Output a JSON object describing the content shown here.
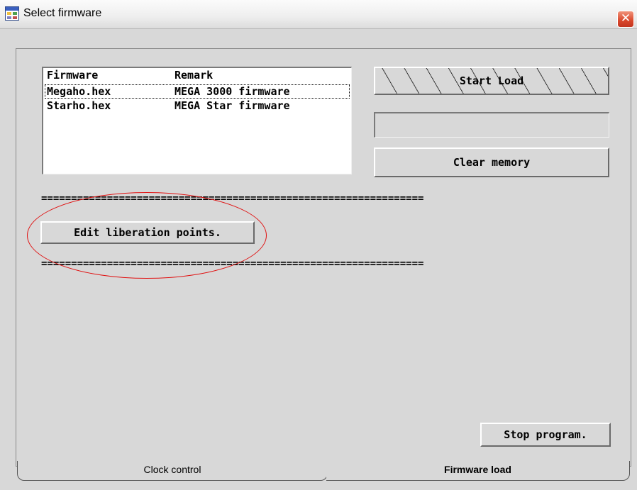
{
  "window": {
    "title": "Select firmware",
    "close_symbol": "✕"
  },
  "firmware_list": {
    "headers": [
      "Firmware",
      "Remark"
    ],
    "rows": [
      {
        "firmware": "Megaho.hex",
        "remark": "MEGA 3000 firmware",
        "selected": true
      },
      {
        "firmware": "Starho.hex",
        "remark": "MEGA Star firmware",
        "selected": false
      }
    ]
  },
  "buttons": {
    "start_load": "Start Load",
    "clear_memory": "Clear memory",
    "edit_liberation": "Edit liberation points.",
    "stop_program": "Stop program."
  },
  "separators": {
    "line1": "================================================================",
    "line2": "================================================================"
  },
  "tabs": [
    {
      "label": "Clock control",
      "active": false
    },
    {
      "label": "Firmware load",
      "active": true
    }
  ],
  "colors": {
    "annotation": "#e01010",
    "close_button": "#d9472b"
  },
  "icons": {
    "app": "app-window-icon",
    "close": "close-icon"
  }
}
